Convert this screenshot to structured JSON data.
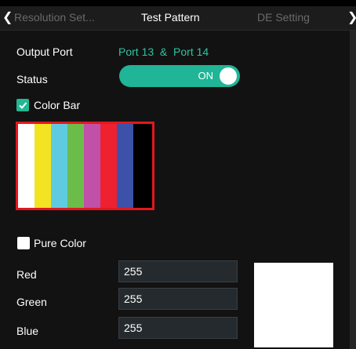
{
  "tabs": [
    {
      "label": "Resolution Set..."
    },
    {
      "label": "Test Pattern"
    },
    {
      "label": "DE Setting"
    }
  ],
  "nav": {
    "prev_icon": "chevron-left-icon",
    "next_icon": "chevron-right-icon"
  },
  "output": {
    "label": "Output Port",
    "value": "Port 13  &  Port 14"
  },
  "status": {
    "label": "Status",
    "toggle_text": "ON",
    "on": true
  },
  "color_bar": {
    "label": "Color Bar",
    "checked": true,
    "stripes": [
      "#ffffff",
      "#f2e423",
      "#5fcbe0",
      "#6cbc4a",
      "#c050a8",
      "#ee2131",
      "#3c52a8",
      "#000000"
    ]
  },
  "pure_color": {
    "label": "Pure Color",
    "checked": false,
    "red_label": "Red",
    "red": "255",
    "green_label": "Green",
    "green": "255",
    "blue_label": "Blue",
    "blue": "255",
    "preview_color": "#ffffff"
  },
  "colors": {
    "accent": "#1fb596",
    "highlight_border": "#e2171e"
  }
}
